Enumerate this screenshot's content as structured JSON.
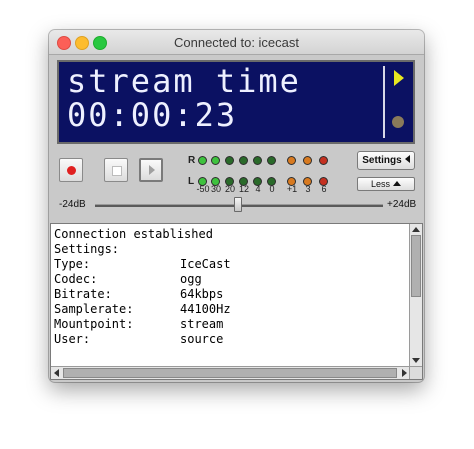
{
  "window": {
    "title": "Connected to: icecast"
  },
  "display": {
    "line1": "stream time",
    "line2": "00:00:23"
  },
  "meter": {
    "right_label": "R",
    "left_label": "L",
    "scale": [
      "-50",
      "30",
      "20",
      "12",
      "4",
      "0",
      "+1",
      "3",
      "6"
    ]
  },
  "buttons": {
    "settings": "Settings",
    "less": "Less"
  },
  "gain": {
    "min": "-24dB",
    "max": "+24dB",
    "level_fraction": 0.5
  },
  "log": {
    "header": [
      "Connection established",
      "Settings:"
    ],
    "rows": [
      {
        "key": "Type:",
        "value": "IceCast"
      },
      {
        "key": "Codec:",
        "value": "ogg"
      },
      {
        "key": "Bitrate:",
        "value": "64kbps"
      },
      {
        "key": "Samplerate:",
        "value": "44100Hz"
      },
      {
        "key": "Mountpoint:",
        "value": "stream"
      },
      {
        "key": "User:",
        "value": "source"
      }
    ]
  },
  "colors": {
    "display_bg": "#0b1162",
    "led_green": "#3ec23e",
    "led_orange": "#d87a20",
    "led_red": "#c43020",
    "indicator_yellow": "#e8e820"
  }
}
